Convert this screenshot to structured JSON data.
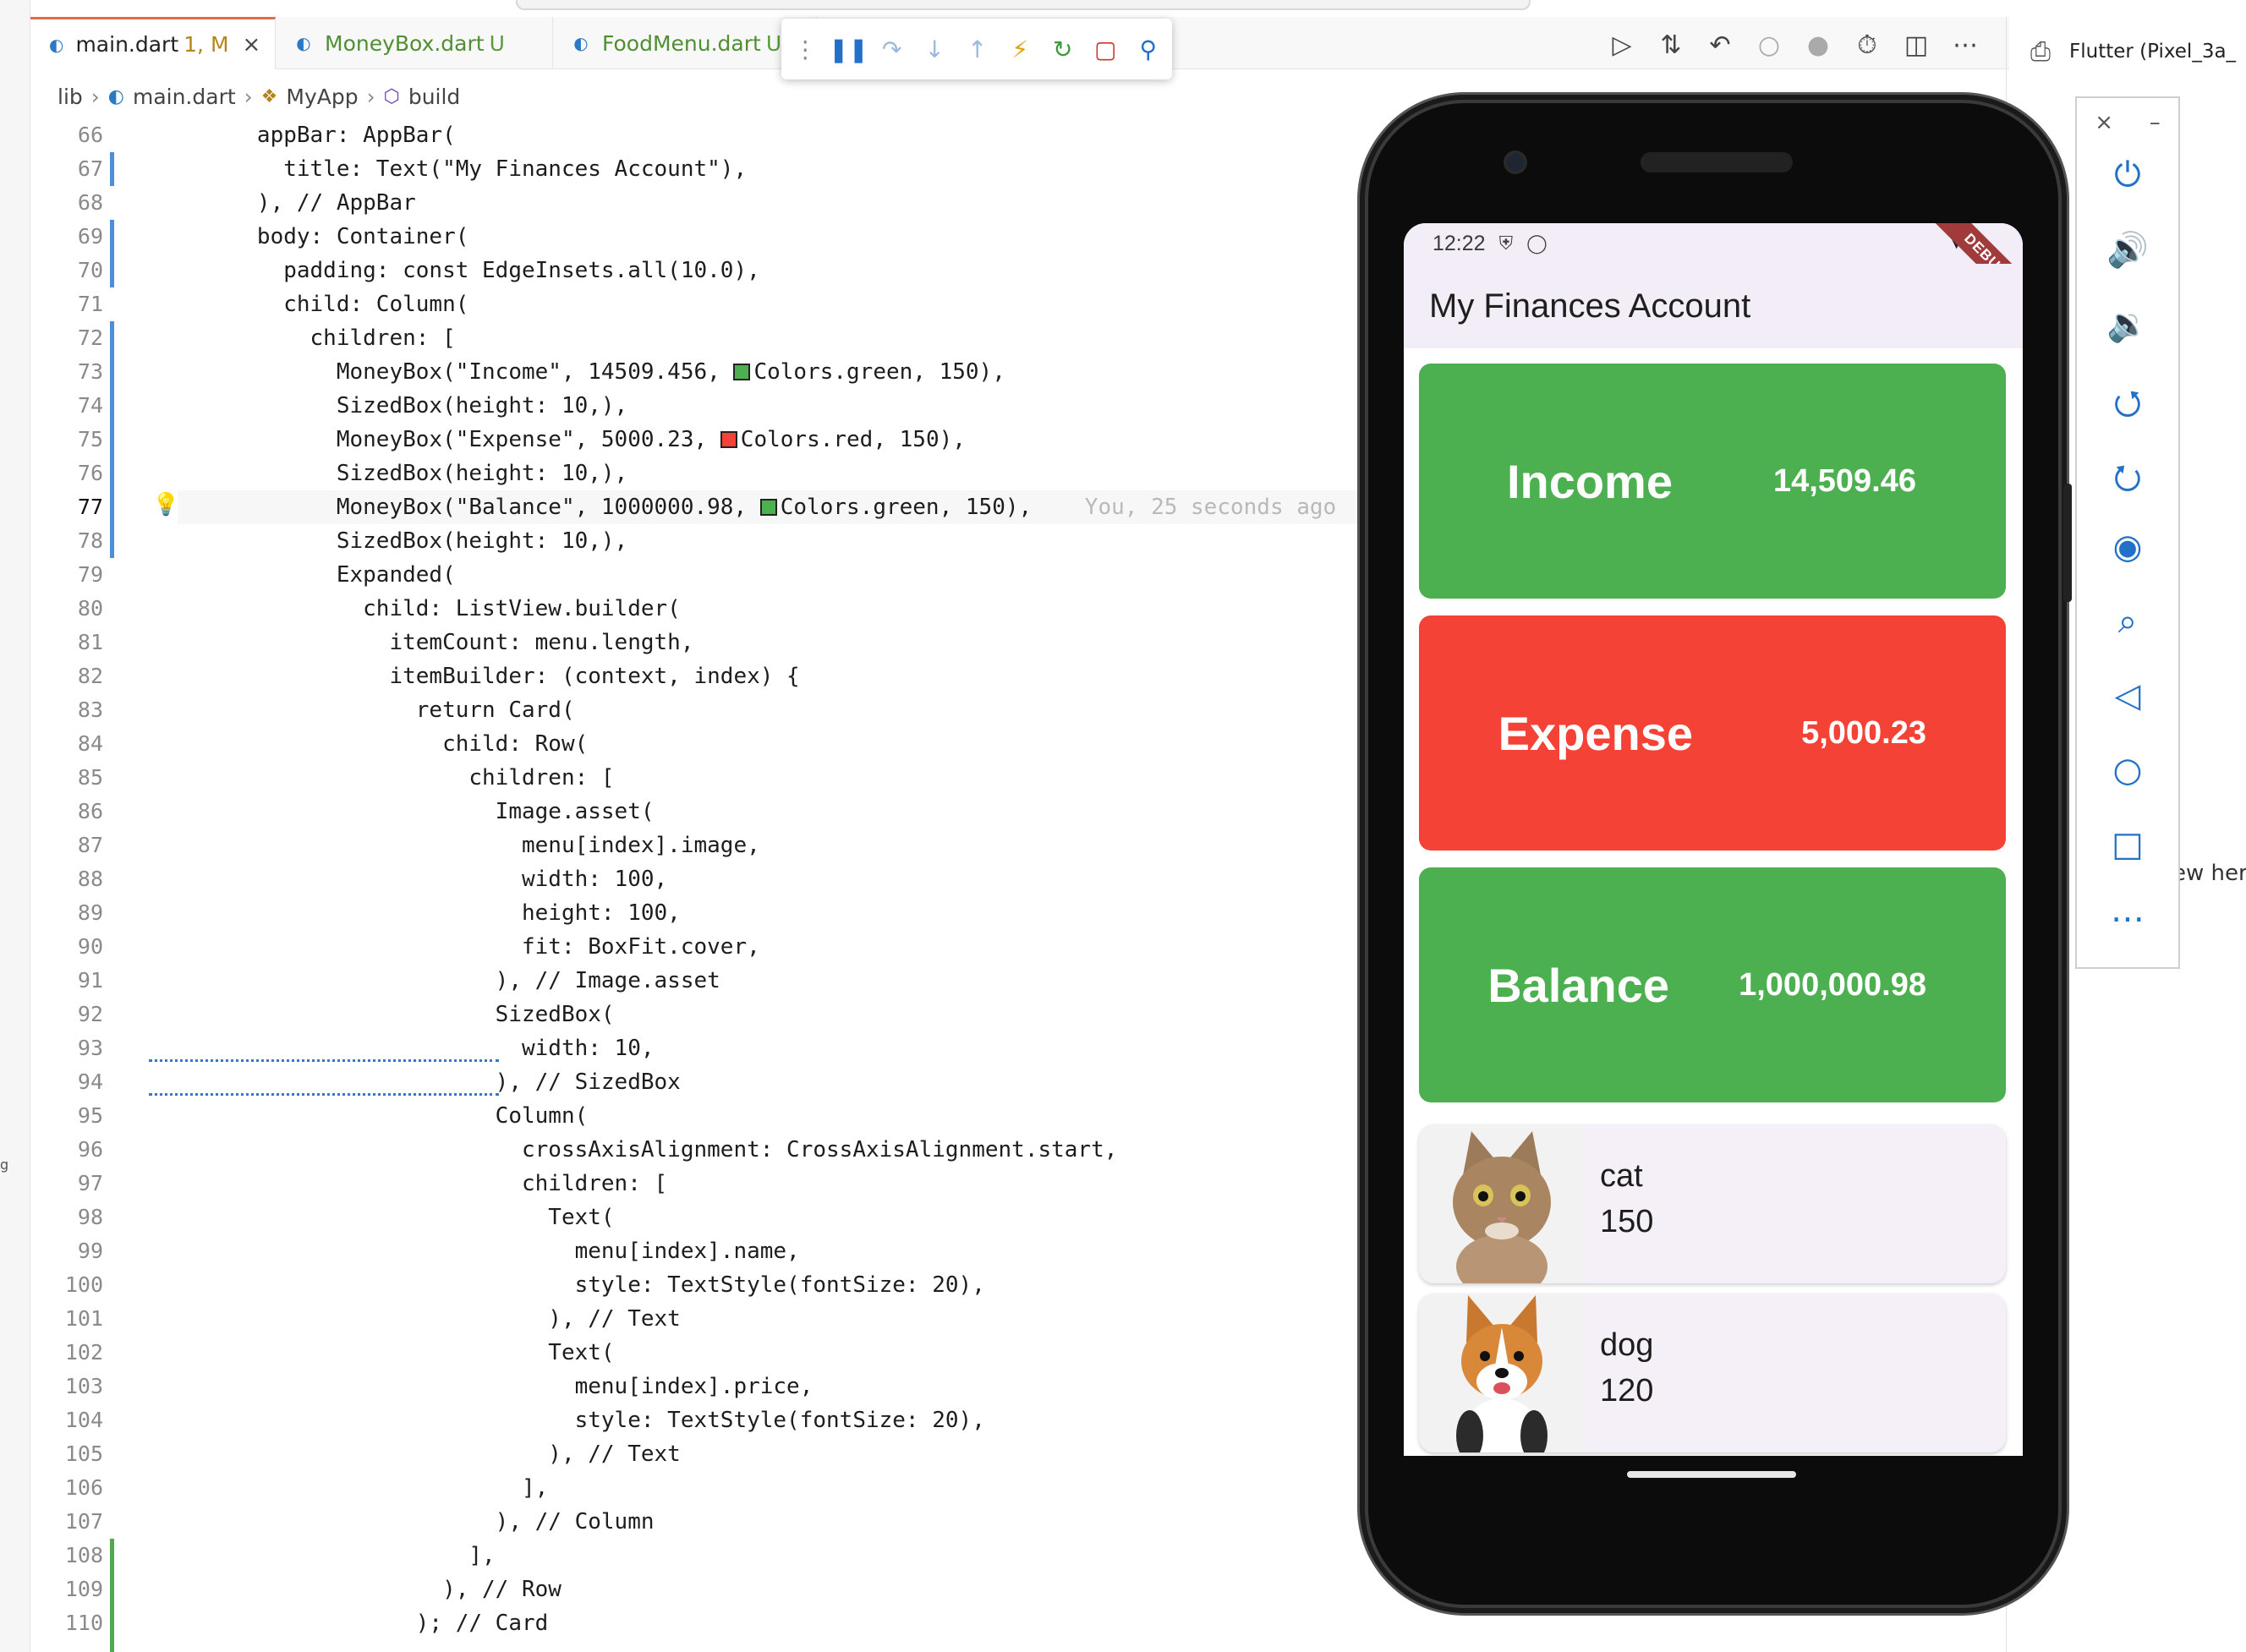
{
  "tabs": [
    {
      "name": "main.dart",
      "status": "1, M",
      "active": true
    },
    {
      "name": "MoneyBox.dart",
      "status": "U",
      "active": false
    },
    {
      "name": "FoodMenu.dart",
      "status": "U",
      "active": false
    }
  ],
  "run_target": "Flutter (Pixel_3a_",
  "right_hint": "ew here",
  "left_fragment": "g",
  "breadcrumb": [
    "lib",
    "main.dart",
    "MyApp",
    "build"
  ],
  "line_numbers": [
    "66",
    "67",
    "68",
    "69",
    "70",
    "71",
    "72",
    "73",
    "74",
    "75",
    "76",
    "77",
    "78",
    "79",
    "80",
    "81",
    "82",
    "83",
    "84",
    "85",
    "86",
    "87",
    "88",
    "89",
    "90",
    "91",
    "92",
    "93",
    "94",
    "95",
    "96",
    "97",
    "98",
    "99",
    "100",
    "101",
    "102",
    "103",
    "104",
    "105",
    "106",
    "107",
    "108",
    "109",
    "110"
  ],
  "current_line": "77",
  "code": [
    "      appBar: AppBar(",
    "        title: Text(\"My Finances Account\"),",
    "      ), // AppBar",
    "      body: Container(",
    "        padding: const EdgeInsets.all(10.0),",
    "        child: Column(",
    "          children: [",
    "            MoneyBox(\"Income\", 14509.456, ",
    "            SizedBox(height: 10,),",
    "            MoneyBox(\"Expense\", 5000.23, ",
    "            SizedBox(height: 10,),",
    "            MoneyBox(\"Balance\", 1000000.98, ",
    "            SizedBox(height: 10,),",
    "            Expanded(",
    "              child: ListView.builder(",
    "                itemCount: menu.length,",
    "                itemBuilder: (context, index) {",
    "                  return Card(",
    "                    child: Row(",
    "                      children: [",
    "                        Image.asset(",
    "                          menu[index].image,",
    "                          width: 100,",
    "                          height: 100,",
    "                          fit: BoxFit.cover,",
    "                        ), // Image.asset",
    "                        SizedBox(",
    "                          width: 10,",
    "                        ), // SizedBox",
    "                        Column(",
    "                          crossAxisAlignment: CrossAxisAlignment.start,",
    "                          children: [",
    "                            Text(",
    "                              menu[index].name,",
    "                              style: TextStyle(fontSize: 20),",
    "                            ), // Text",
    "                            Text(",
    "                              menu[index].price,",
    "                              style: TextStyle(fontSize: 20),",
    "                            ), // Text",
    "                          ],",
    "                        ), // Column",
    "                      ],",
    "                    ), // Row",
    "                  ); // Card"
  ],
  "code_color_suffix": {
    "income": "Colors.green, 150),",
    "expense": "Colors.red, 150),",
    "balance": "Colors.green, 150),"
  },
  "blame": "You, 25 seconds ago",
  "swatch_colors": {
    "green": "#4caf50",
    "red": "#f44336"
  },
  "phone": {
    "time": "12:22",
    "ribbon": "DEBUG",
    "app_title": "My Finances Account",
    "money_boxes": [
      {
        "title": "Income",
        "value": "14,509.46",
        "color": "#4caf50"
      },
      {
        "title": "Expense",
        "value": "5,000.23",
        "color": "#f44336"
      },
      {
        "title": "Balance",
        "value": "1,000,000.98",
        "color": "#4caf50"
      }
    ],
    "menu": [
      {
        "name": "cat",
        "price": "150",
        "image_icon": "cat-photo"
      },
      {
        "name": "dog",
        "price": "120",
        "image_icon": "dog-photo"
      }
    ]
  },
  "emulator_tools": [
    "power-icon",
    "volume-up-icon",
    "volume-down-icon",
    "rotate-left-icon",
    "rotate-right-icon",
    "camera-icon",
    "zoom-icon",
    "back-icon",
    "home-icon",
    "overview-icon",
    "more-icon"
  ]
}
